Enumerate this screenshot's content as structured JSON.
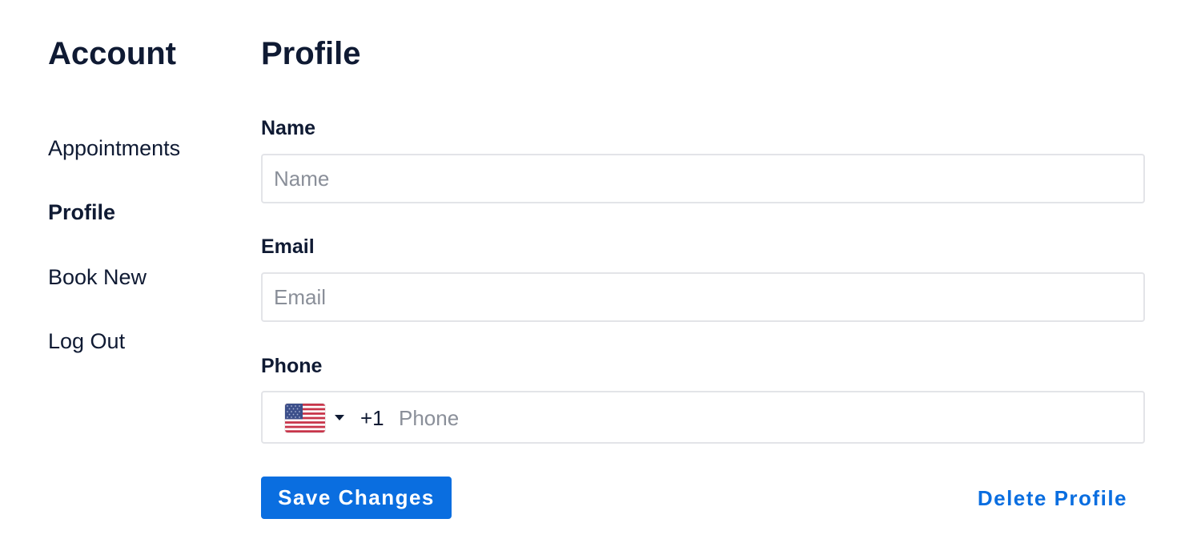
{
  "sidebar": {
    "title": "Account",
    "items": [
      {
        "label": "Appointments",
        "active": false
      },
      {
        "label": "Profile",
        "active": true
      },
      {
        "label": "Book New",
        "active": false
      },
      {
        "label": "Log Out",
        "active": false
      }
    ]
  },
  "main": {
    "title": "Profile",
    "fields": {
      "name": {
        "label": "Name",
        "placeholder": "Name",
        "value": ""
      },
      "email": {
        "label": "Email",
        "placeholder": "Email",
        "value": ""
      },
      "phone": {
        "label": "Phone",
        "dial_code": "+1",
        "country_icon": "us-flag-icon",
        "placeholder": "Phone",
        "value": ""
      }
    },
    "actions": {
      "save_label": "Save Changes",
      "delete_label": "Delete Profile"
    }
  },
  "colors": {
    "primary": "#0a6ee0",
    "text": "#0f1a33",
    "placeholder": "#8a8f99",
    "border": "#e3e4e8"
  }
}
